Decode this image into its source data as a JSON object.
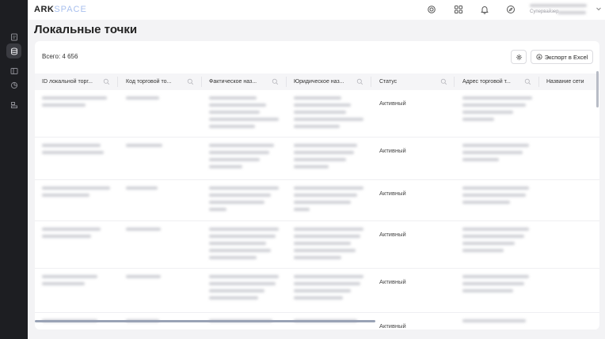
{
  "app": {
    "logo_part1": "ARK",
    "logo_part2": "SPACE",
    "user_role": "Супервайзер"
  },
  "page": {
    "title": "Локальные точки",
    "total": "Всего: 4 656",
    "export_label": "Экспорт в Excel"
  },
  "sidebar": {
    "items": [
      {
        "icon": "document-icon",
        "active": false
      },
      {
        "icon": "database-icon",
        "active": true
      },
      {
        "icon": "panel-icon",
        "active": false
      },
      {
        "icon": "chart-icon",
        "active": false
      },
      {
        "icon": "layers-icon",
        "active": false
      }
    ]
  },
  "topbar_icons": [
    "support-icon",
    "apps-grid-icon",
    "bell-icon",
    "compass-icon"
  ],
  "table": {
    "columns": [
      "ID локальной торг...",
      "Код торговой то...",
      "Фактическое наз...",
      "Юридическое наз...",
      "Статус",
      "Адрес торговой т...",
      "Название сети"
    ],
    "rows": [
      {
        "status": "Активный"
      },
      {
        "status": "Активный"
      },
      {
        "status": "Активный"
      },
      {
        "status": "Активный"
      },
      {
        "status": "Активный"
      },
      {
        "status": "Активный"
      }
    ]
  },
  "colors": {
    "sidebar_bg": "#1d1e22",
    "logo_accent": "#a9c0ee",
    "page_bg": "#f3f3f5"
  }
}
